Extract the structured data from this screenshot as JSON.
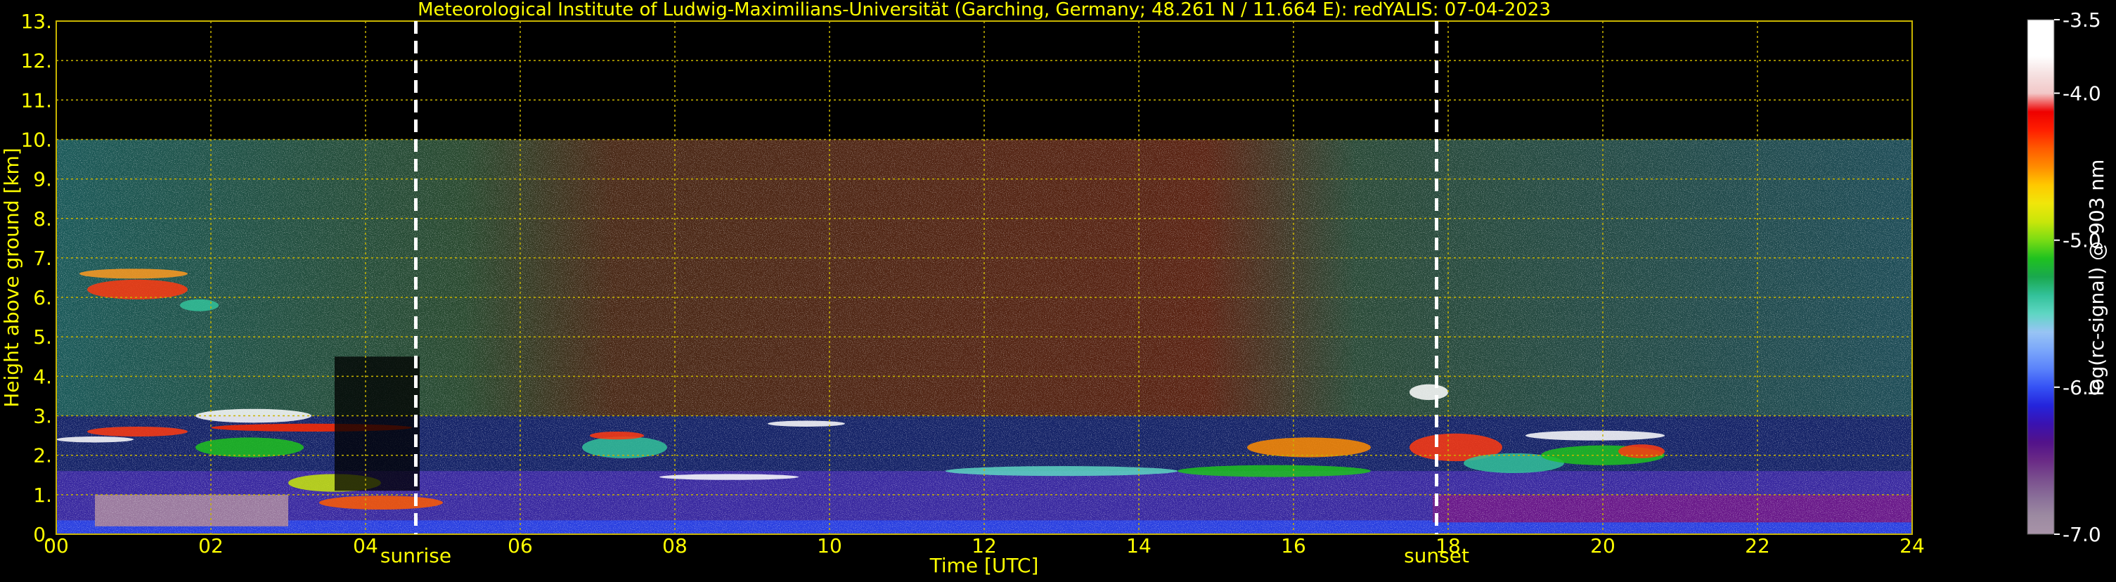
{
  "chart_data": {
    "type": "heatmap",
    "title": "Meteorological Institute of Ludwig-Maximilians-Universität (Garching, Germany; 48.261 N / 11.664 E):    redYALIS: 07-04-2023",
    "xlabel": "Time [UTC]",
    "ylabel": "Height above ground [km]",
    "xlim": [
      0,
      24
    ],
    "ylim": [
      0,
      13
    ],
    "x_ticks": [
      "00",
      "02",
      "04",
      "06",
      "08",
      "10",
      "12",
      "14",
      "16",
      "18",
      "20",
      "22",
      "24"
    ],
    "y_ticks": [
      "0.",
      "1.",
      "2.",
      "3.",
      "4.",
      "5.",
      "6.",
      "7.",
      "8.",
      "9.",
      "10.",
      "11.",
      "12.",
      "13."
    ],
    "grid": true,
    "data_top_km": 10,
    "events": [
      {
        "label": "sunrise",
        "time": 4.65
      },
      {
        "label": "sunset",
        "time": 17.85
      }
    ],
    "colorbar": {
      "label": "log(rc-signal) @ 903 nm",
      "range": [
        -7.0,
        -3.5
      ],
      "ticks": [
        "-3.5",
        "-4.0",
        "-5.0",
        "-6.0",
        "-7.0"
      ],
      "tick_values": [
        -3.5,
        -4.0,
        -5.0,
        -6.0,
        -7.0
      ],
      "colors": [
        "#a893a8",
        "#9c8aa1",
        "#8a6f99",
        "#7a4f8e",
        "#6a2a86",
        "#52128a",
        "#3a12b0",
        "#2424dc",
        "#3552f5",
        "#5a82fa",
        "#7aa6fa",
        "#98c4f4",
        "#5ed6c2",
        "#33c29a",
        "#19a84e",
        "#1fc21f",
        "#78dc14",
        "#c8e60a",
        "#f0e60a",
        "#ffc800",
        "#ff8c00",
        "#ff5a00",
        "#ff1e00",
        "#ee0000",
        "#f2c8c8",
        "#f5e0e0",
        "#ffffff",
        "#ffffff",
        "#ffffff"
      ]
    }
  },
  "colors": {
    "annotation": "#ffff00",
    "grid": "#c8b400",
    "background": "#000000",
    "event_line": "#ffffff"
  }
}
